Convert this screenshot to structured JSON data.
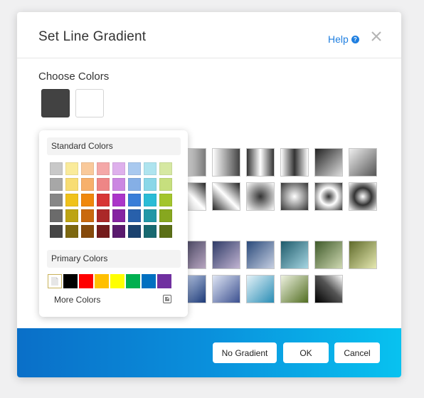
{
  "dialog": {
    "title": "Set Line Gradient",
    "help_label": "Help",
    "choose_colors_label": "Choose Colors",
    "choose_swatches": [
      "#424242",
      "#ffffff"
    ]
  },
  "popup": {
    "standard_label": "Standard Colors",
    "standard_grid": [
      [
        "#c8c8c8",
        "#faeb9a",
        "#f9c99a",
        "#f4a8a8",
        "#deb0ec",
        "#a9c9ef",
        "#aee4ef",
        "#d6e8a2"
      ],
      [
        "#a7a7a7",
        "#f8dd73",
        "#f7b06b",
        "#ee8686",
        "#cb87e2",
        "#85afe6",
        "#8ad7e8",
        "#c6df7e"
      ],
      [
        "#878787",
        "#f0c21a",
        "#f0880d",
        "#d73535",
        "#ab36c9",
        "#3a7ed8",
        "#2bbcd6",
        "#a3c52d"
      ],
      [
        "#6b6b6b",
        "#bda413",
        "#c9690e",
        "#ab2828",
        "#8523a2",
        "#2860ab",
        "#2297a6",
        "#87a71f"
      ],
      [
        "#464646",
        "#7d6810",
        "#864a0b",
        "#741b1b",
        "#5a1a6e",
        "#1b426f",
        "#186970",
        "#5b6f17"
      ]
    ],
    "primary_label": "Primary Colors",
    "primary_colors": [
      "#000000",
      "#ff0000",
      "#ffc000",
      "#ffff00",
      "#00b050",
      "#0070c0",
      "#7030a0"
    ],
    "more_colors_label": "More Colors"
  },
  "footer": {
    "no_gradient_label": "No Gradient",
    "ok_label": "OK",
    "cancel_label": "Cancel"
  }
}
